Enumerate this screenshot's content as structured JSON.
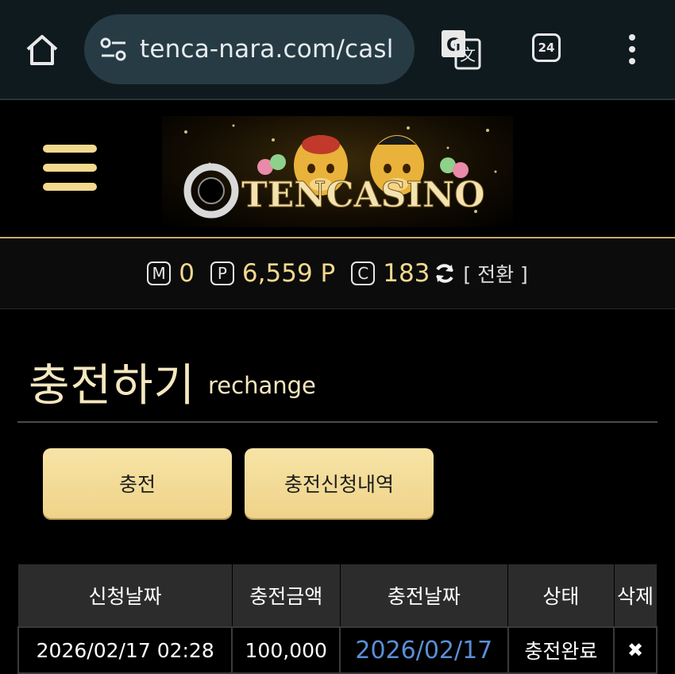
{
  "browser": {
    "url": "tenca-nara.com/casl",
    "tab_count": "24"
  },
  "site": {
    "logo_text": "TENCASINO"
  },
  "points": {
    "m_icon": "M",
    "m_value": "0",
    "p_icon": "P",
    "p_value": "6,559 P",
    "c_icon": "C",
    "c_value": "183",
    "switch_label": "[ 전환 ]"
  },
  "page": {
    "title": "충전하기",
    "subtitle": "rechange"
  },
  "buttons": {
    "charge": "충전",
    "history": "충전신청내역"
  },
  "table": {
    "headers": [
      "신청날짜",
      "충전금액",
      "충전날짜",
      "상태",
      "삭제"
    ],
    "rows": [
      {
        "request_date": "2026/02/17 02:28",
        "amount": "100,000",
        "charge_date": "2026/02/17",
        "status": "충전완료",
        "delete": "✖"
      }
    ]
  },
  "colors": {
    "gold": "#f3d98e",
    "button_bg": "#f7e4a6",
    "link_blue": "#5b8fd6"
  }
}
